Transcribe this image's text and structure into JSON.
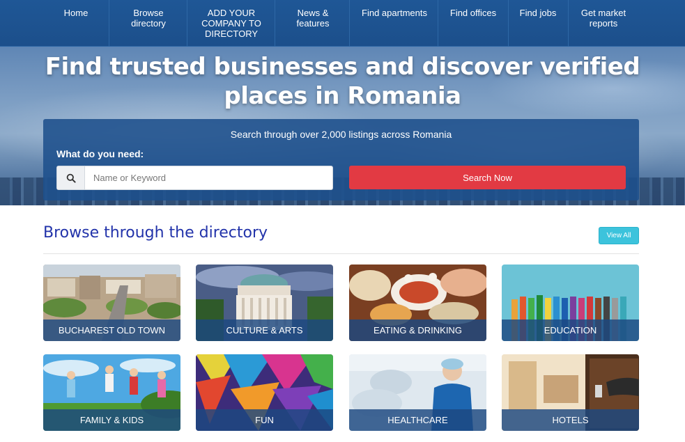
{
  "nav": {
    "items": [
      {
        "label": "Home"
      },
      {
        "label": "Browse directory"
      },
      {
        "label": "ADD YOUR COMPANY TO DIRECTORY"
      },
      {
        "label": "News & features"
      },
      {
        "label": "Find apartments"
      },
      {
        "label": "Find offices"
      },
      {
        "label": "Find jobs"
      },
      {
        "label": "Get market reports"
      }
    ]
  },
  "hero": {
    "title": "Find trusted businesses and discover verified places in Romania",
    "search_caption": "Search through over 2,000 listings across Romania",
    "search_label": "What do you need:",
    "search_placeholder": "Name or Keyword",
    "search_value": "",
    "search_button": "Search Now"
  },
  "directory": {
    "title": "Browse through the directory",
    "view_all": "View All",
    "categories": [
      {
        "label": "BUCHAREST OLD TOWN"
      },
      {
        "label": "CULTURE & ARTS"
      },
      {
        "label": "EATING & DRINKING"
      },
      {
        "label": "EDUCATION"
      },
      {
        "label": "FAMILY & KIDS"
      },
      {
        "label": "FUN"
      },
      {
        "label": "HEALTHCARE"
      },
      {
        "label": "HOTELS"
      }
    ]
  },
  "colors": {
    "nav_bg": "#1f5796",
    "search_button": "#e23a43",
    "view_all": "#3cc3dc",
    "section_title": "#2233aa"
  }
}
